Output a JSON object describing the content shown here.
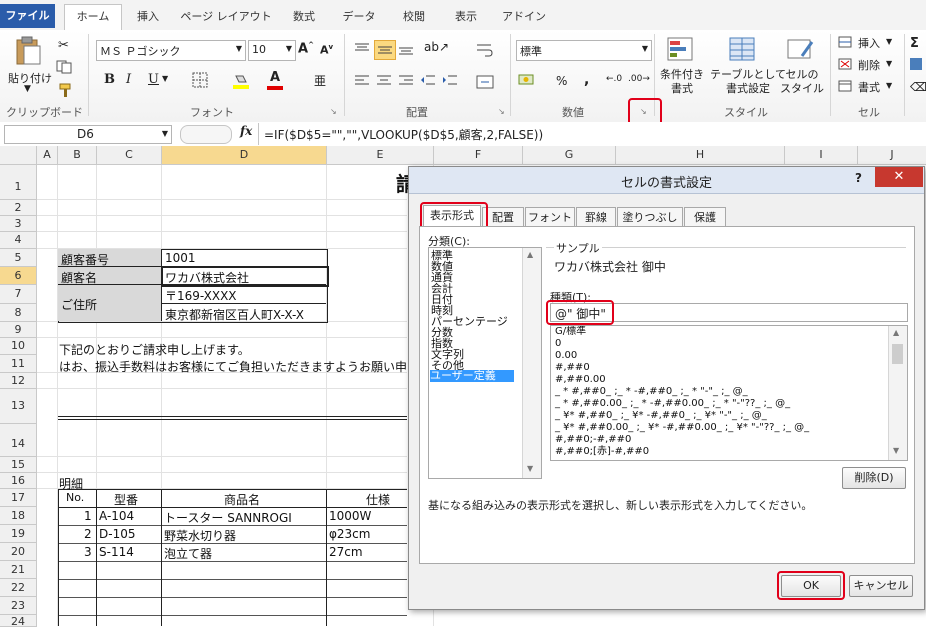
{
  "ribbon": {
    "tabs": [
      "ファイル",
      "ホーム",
      "挿入",
      "ページ レイアウト",
      "数式",
      "データ",
      "校閲",
      "表示",
      "アドイン"
    ],
    "clipboard": {
      "paste": "貼り付け",
      "label": "クリップボード"
    },
    "font": {
      "name": "ＭＳ Ｐゴシック",
      "size": "10",
      "bold": "B",
      "italic": "I",
      "underline": "U",
      "label": "フォント"
    },
    "alignment": {
      "label": "配置"
    },
    "number": {
      "format": "標準",
      "percent": "%",
      "comma": ",",
      "label": "数値"
    },
    "styles": {
      "conditional": "条件付き\n書式",
      "table": "テーブルとして\n書式設定",
      "cell": "セルの\nスタイル",
      "label": "スタイル"
    },
    "cells": {
      "insert": "挿入",
      "delete": "削除",
      "format": "書式",
      "label": "セル"
    }
  },
  "formula_bar": {
    "name_box": "D6",
    "fx": "fx",
    "formula": "=IF($D$5=\"\",\"\",VLOOKUP($D$5,顧客,2,FALSE))"
  },
  "sheet": {
    "columns": [
      "A",
      "B",
      "C",
      "D",
      "E",
      "F",
      "G",
      "H",
      "I",
      "J"
    ],
    "rows": [
      "1",
      "2",
      "3",
      "4",
      "5",
      "6",
      "7",
      "8",
      "9",
      "10",
      "11",
      "12",
      "13",
      "14",
      "15",
      "16",
      "17",
      "18",
      "19",
      "20",
      "21",
      "22",
      "23",
      "24"
    ],
    "title_char": "請",
    "cust_no_label": "顧客番号",
    "cust_no": "1001",
    "cust_name_label": "顧客名",
    "cust_name": "ワカバ株式会社",
    "address_label": "ご住所",
    "zip": "〒169-XXXX",
    "address": "東京都新宿区百人町X-X-X",
    "msg1": "下記のとおりご請求申し上げます。",
    "msg2": "はお、振込手数料はお客様にてご負担いただきますようお願い申",
    "meisai": "明細",
    "headers": {
      "no": "No.",
      "code": "型番",
      "name": "商品名",
      "spec": "仕様"
    },
    "items": [
      {
        "no": "1",
        "code": "A-104",
        "name": "トースター SANNROGI",
        "spec": "1000W"
      },
      {
        "no": "2",
        "code": "D-105",
        "name": "野菜水切り器",
        "spec": "φ23cm"
      },
      {
        "no": "3",
        "code": "S-114",
        "name": "泡立て器",
        "spec": "27cm"
      }
    ]
  },
  "dialog": {
    "title": "セルの書式設定",
    "help": "?",
    "tabs": [
      "表示形式",
      "配置",
      "フォント",
      "罫線",
      "塗りつぶし",
      "保護"
    ],
    "category_label": "分類(C):",
    "categories": [
      "標準",
      "数値",
      "通貨",
      "会計",
      "日付",
      "時刻",
      "パーセンテージ",
      "分数",
      "指数",
      "文字列",
      "その他",
      "ユーザー定義"
    ],
    "selected_category": "ユーザー定義",
    "sample_label": "サンプル",
    "sample_value": "ワカバ株式会社 御中",
    "type_label": "種類(T):",
    "type_value": "@\" 御中\"",
    "formats": [
      "G/標準",
      "0",
      "0.00",
      "#,##0",
      "#,##0.00",
      "_ * #,##0_ ;_ * -#,##0_ ;_ * \"-\"_ ;_ @_",
      "_ * #,##0.00_ ;_ * -#,##0.00_ ;_ * \"-\"??_ ;_ @_",
      "_ ¥* #,##0_ ;_ ¥* -#,##0_ ;_ ¥* \"-\"_ ;_ @_",
      "_ ¥* #,##0.00_ ;_ ¥* -#,##0.00_ ;_ ¥* \"-\"??_ ;_ @_",
      "#,##0;-#,##0",
      "#,##0;[赤]-#,##0"
    ],
    "delete_button": "削除(D)",
    "description": "基になる組み込みの表示形式を選択し、新しい表示形式を入力してください。",
    "ok": "OK",
    "cancel": "キャンセル"
  }
}
